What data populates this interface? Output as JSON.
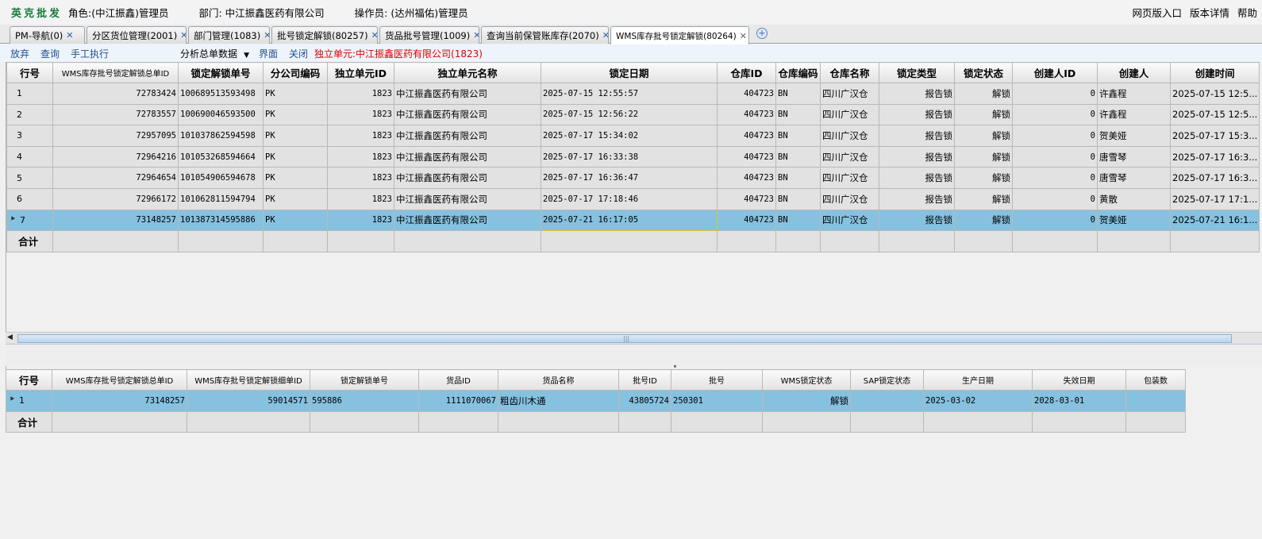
{
  "app": {
    "brand": "英克批发",
    "role": "角色:(中江振鑫)管理员",
    "department": "部门: 中江振鑫医药有限公司",
    "operator": "操作员: (达州福佑)管理员",
    "links": [
      "网页版入口",
      "版本详情",
      "帮助"
    ]
  },
  "tabs": [
    {
      "label": "PM-导航(0)",
      "active": false
    },
    {
      "label": "分区货位管理(2001)",
      "active": false
    },
    {
      "label": "部门管理(1083)",
      "active": false
    },
    {
      "label": "批号锁定解锁(80257)",
      "active": false
    },
    {
      "label": "货品批号管理(1009)",
      "active": false
    },
    {
      "label": "查询当前保管账库存(2070)",
      "active": false
    },
    {
      "label": "WMS库存批号锁定解锁(80264)",
      "active": true
    }
  ],
  "toolbar": {
    "discard": "放弃",
    "query": "查询",
    "manual_exec": "手工执行",
    "analysis": "分析总单数据",
    "interface": "界面",
    "close": "关闭",
    "unit": "独立单元:中江振鑫医药有限公司(1823)"
  },
  "master": {
    "columns": [
      "行号",
      "WMS库存批号锁定解锁总单ID",
      "锁定解锁单号",
      "分公司编码",
      "独立单元ID",
      "独立单元名称",
      "锁定日期",
      "仓库ID",
      "仓库编码",
      "仓库名称",
      "锁定类型",
      "锁定状态",
      "创建人ID",
      "创建人",
      "创建时间"
    ],
    "rows": [
      [
        "1",
        "72783424",
        "100689513593498",
        "PK",
        "1823",
        "中江振鑫医药有限公司",
        "2025-07-15 12:55:57",
        "404723",
        "BN",
        "四川广汉仓",
        "报告锁",
        "解锁",
        "0",
        "许鑫程",
        "2025-07-15 12:5..."
      ],
      [
        "2",
        "72783557",
        "100690046593500",
        "PK",
        "1823",
        "中江振鑫医药有限公司",
        "2025-07-15 12:56:22",
        "404723",
        "BN",
        "四川广汉仓",
        "报告锁",
        "解锁",
        "0",
        "许鑫程",
        "2025-07-15 12:5..."
      ],
      [
        "3",
        "72957095",
        "101037862594598",
        "PK",
        "1823",
        "中江振鑫医药有限公司",
        "2025-07-17 15:34:02",
        "404723",
        "BN",
        "四川广汉仓",
        "报告锁",
        "解锁",
        "0",
        "贺美娅",
        "2025-07-17 15:3..."
      ],
      [
        "4",
        "72964216",
        "101053268594664",
        "PK",
        "1823",
        "中江振鑫医药有限公司",
        "2025-07-17 16:33:38",
        "404723",
        "BN",
        "四川广汉仓",
        "报告锁",
        "解锁",
        "0",
        "唐雪琴",
        "2025-07-17 16:3..."
      ],
      [
        "5",
        "72964654",
        "101054906594678",
        "PK",
        "1823",
        "中江振鑫医药有限公司",
        "2025-07-17 16:36:47",
        "404723",
        "BN",
        "四川广汉仓",
        "报告锁",
        "解锁",
        "0",
        "唐雪琴",
        "2025-07-17 16:3..."
      ],
      [
        "6",
        "72966172",
        "101062811594794",
        "PK",
        "1823",
        "中江振鑫医药有限公司",
        "2025-07-17 17:18:46",
        "404723",
        "BN",
        "四川广汉仓",
        "报告锁",
        "解锁",
        "0",
        "黄散",
        "2025-07-17 17:1..."
      ],
      [
        "7",
        "73148257",
        "101387314595886",
        "PK",
        "1823",
        "中江振鑫医药有限公司",
        "2025-07-21 16:17:05",
        "404723",
        "BN",
        "四川广汉仓",
        "报告锁",
        "解锁",
        "0",
        "贺美娅",
        "2025-07-21 16:1..."
      ]
    ],
    "selected_row": 7,
    "total_label": "合计"
  },
  "detail": {
    "columns": [
      "行号",
      "WMS库存批号锁定解锁总单ID",
      "WMS库存批号锁定解锁细单ID",
      "锁定解锁单号",
      "货品ID",
      "货品名称",
      "批号ID",
      "批号",
      "WMS锁定状态",
      "SAP锁定状态",
      "生产日期",
      "失效日期",
      "包装数"
    ],
    "rows": [
      [
        "1",
        "73148257",
        "59014571",
        "595886",
        "1111070067",
        "粗齿川木通",
        "43805724",
        "250301",
        "解锁",
        "",
        "2025-03-02",
        "2028-03-01",
        ""
      ]
    ],
    "total_label": "合计"
  },
  "colors": {
    "selected_row": "#86c1e0",
    "brand": "#1a7a3a",
    "unit_text": "#e00000",
    "link": "#1f4f8f"
  }
}
